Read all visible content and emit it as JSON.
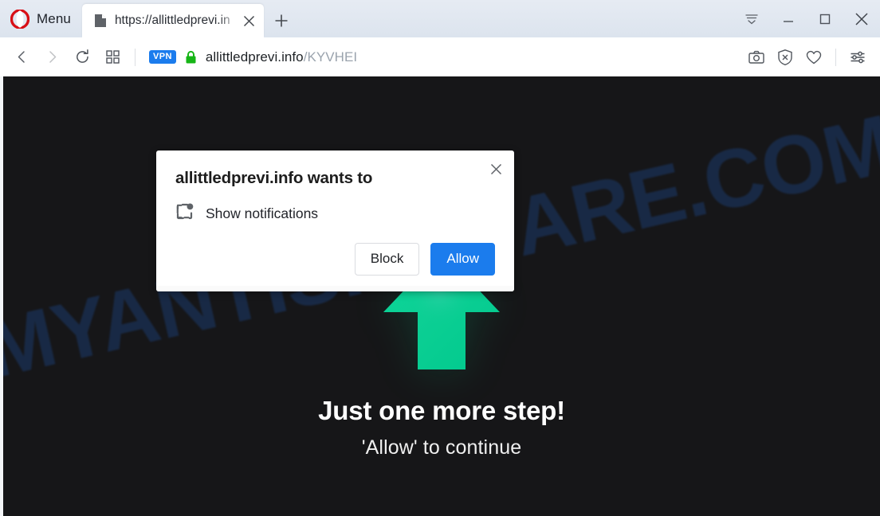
{
  "window": {
    "menu_label": "Menu",
    "controls": [
      {
        "name": "tab-menu",
        "icon": "tab-menu-icon"
      },
      {
        "name": "minimize",
        "icon": "minimize-icon"
      },
      {
        "name": "maximize",
        "icon": "maximize-icon"
      },
      {
        "name": "close",
        "icon": "close-icon"
      }
    ]
  },
  "tabs": [
    {
      "title": "https://allittledprevi.in",
      "favicon": "page-icon",
      "close_label": "×",
      "active": true
    }
  ],
  "new_tab_label": "+",
  "toolbar": {
    "back": "back-icon",
    "forward": "forward-icon",
    "reload": "reload-icon",
    "speed_dial": "speed-dial-icon",
    "vpn_badge": "VPN",
    "lock": "lock-icon",
    "url_host": "allittledprevi.info",
    "url_path": "/KYVHEI",
    "right_icons": [
      {
        "name": "snapshot-icon"
      },
      {
        "name": "ad-blocker-icon"
      },
      {
        "name": "heart-icon"
      },
      {
        "name": "easy-setup-icon"
      }
    ]
  },
  "dialog": {
    "title": "allittledprevi.info wants to",
    "permission_label": "Show notifications",
    "permission_icon": "notification-icon",
    "block_label": "Block",
    "allow_label": "Allow",
    "close_label": "✕",
    "allow_color": "#1b7ced"
  },
  "page": {
    "headline": "Just one more step!",
    "subline": "'Allow' to continue",
    "arrow_icon": "up-arrow-icon",
    "arrow_color": "#00d18f",
    "background_color": "#161618",
    "watermark_text": "MYANTISPYWARE.COM",
    "watermark_color": "#1b3a6b"
  }
}
